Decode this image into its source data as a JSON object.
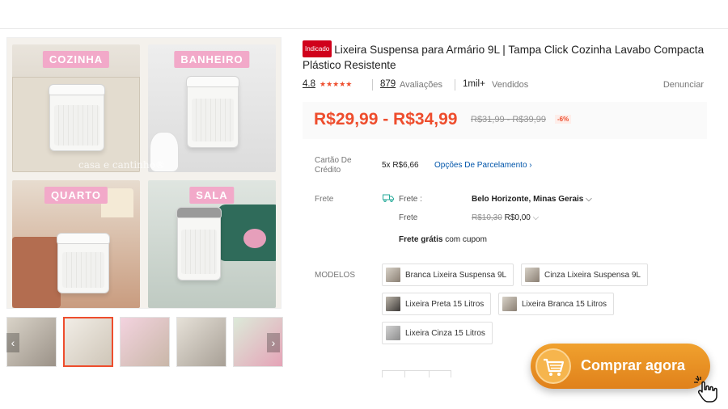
{
  "gallery": {
    "tiles": [
      "COZINHA",
      "BANHEIRO",
      "QUARTO",
      "SALA"
    ],
    "watermark": "casa e cantinho®"
  },
  "product": {
    "badge": "Indicado",
    "title": "Lixeira Suspensa para Armário 9L | Tampa Click Cozinha Lavabo Compacta Plástico Resistente",
    "rating": "4.8",
    "stars": "★★★★★",
    "reviews_count": "879",
    "reviews_label": "Avaliações",
    "sold_count": "1mil+",
    "sold_label": "Vendidos",
    "report": "Denunciar"
  },
  "price": {
    "range": "R$29,99 - R$34,99",
    "old_range": "R$31,99 - R$39,99",
    "discount": "-6%"
  },
  "installments": {
    "label": "Cartão De Crédito",
    "value": "5x R$6,66",
    "link": "Opções De Parcelamento ›"
  },
  "shipping": {
    "label": "Frete",
    "to_label": "Frete :",
    "destination": "Belo Horizonte, Minas Gerais",
    "cost_label": "Frete",
    "old_cost": "R$10,30",
    "cost": "R$0,00",
    "free_bold": "Frete grátis",
    "free_rest": " com cupom"
  },
  "models": {
    "label": "MODELOS",
    "options": [
      "Branca Lixeira Suspensa 9L",
      "Cinza Lixeira Suspensa 9L",
      "Lixeira Preta 15 Litros",
      "Lixeira Branca 15 Litros",
      "Lixeira Cinza 15 Litros"
    ]
  },
  "cta": {
    "label": "Comprar agora"
  },
  "colors": {
    "accent": "#ee4d2d",
    "cta": "#e8901f",
    "link": "#0055aa"
  }
}
